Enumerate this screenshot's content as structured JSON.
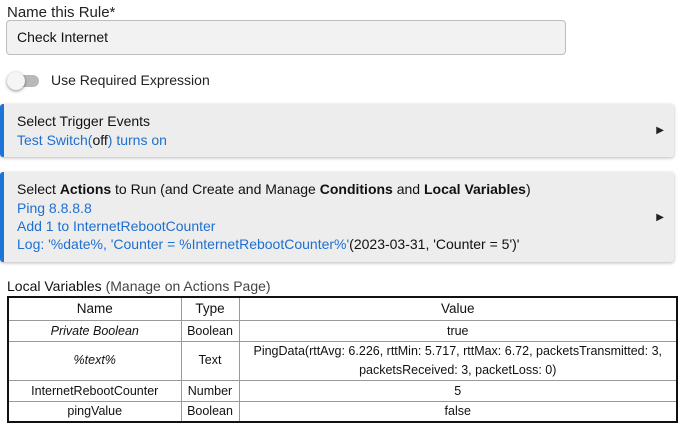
{
  "rule": {
    "name_label": "Name this Rule*",
    "name_value": "Check Internet"
  },
  "required_expression": {
    "label": "Use Required Expression",
    "enabled": false
  },
  "trigger_panel": {
    "title": "Select Trigger Events",
    "line_prefix": "Test Switch(",
    "line_state": "off",
    "line_suffix": ") turns on",
    "arrow": "▶"
  },
  "actions_panel": {
    "title_parts": [
      "Select ",
      "Actions",
      " to Run (and Create and Manage ",
      "Conditions",
      " and ",
      "Local Variables",
      ")"
    ],
    "actions": [
      "Ping 8.8.8.8",
      "Add 1 to InternetRebootCounter"
    ],
    "log_prefix": "Log: '%date%, 'Counter =  %InternetRebootCounter%'",
    "log_value": "(2023-03-31, 'Counter =  5')'",
    "arrow": "▶"
  },
  "local_variables": {
    "heading": "Local Variables",
    "heading_note": "(Manage on Actions Page)",
    "columns": [
      "Name",
      "Type",
      "Value"
    ],
    "rows": [
      {
        "name": "Private Boolean",
        "type": "Boolean",
        "value": "true"
      },
      {
        "name": "%text%",
        "type": "Text",
        "value_line1": "PingData(rttAvg: 6.226, rttMin: 5.717, rttMax: 6.72, packetsTransmitted: 3,",
        "value_line2": "packetsReceived: 3, packetLoss: 0)"
      },
      {
        "name": "InternetRebootCounter",
        "type": "Number",
        "value": "5"
      },
      {
        "name": "pingValue",
        "type": "Boolean",
        "value": "false"
      }
    ]
  },
  "colors": {
    "accent": "#1e74d6",
    "panel_bg": "#ededed"
  }
}
